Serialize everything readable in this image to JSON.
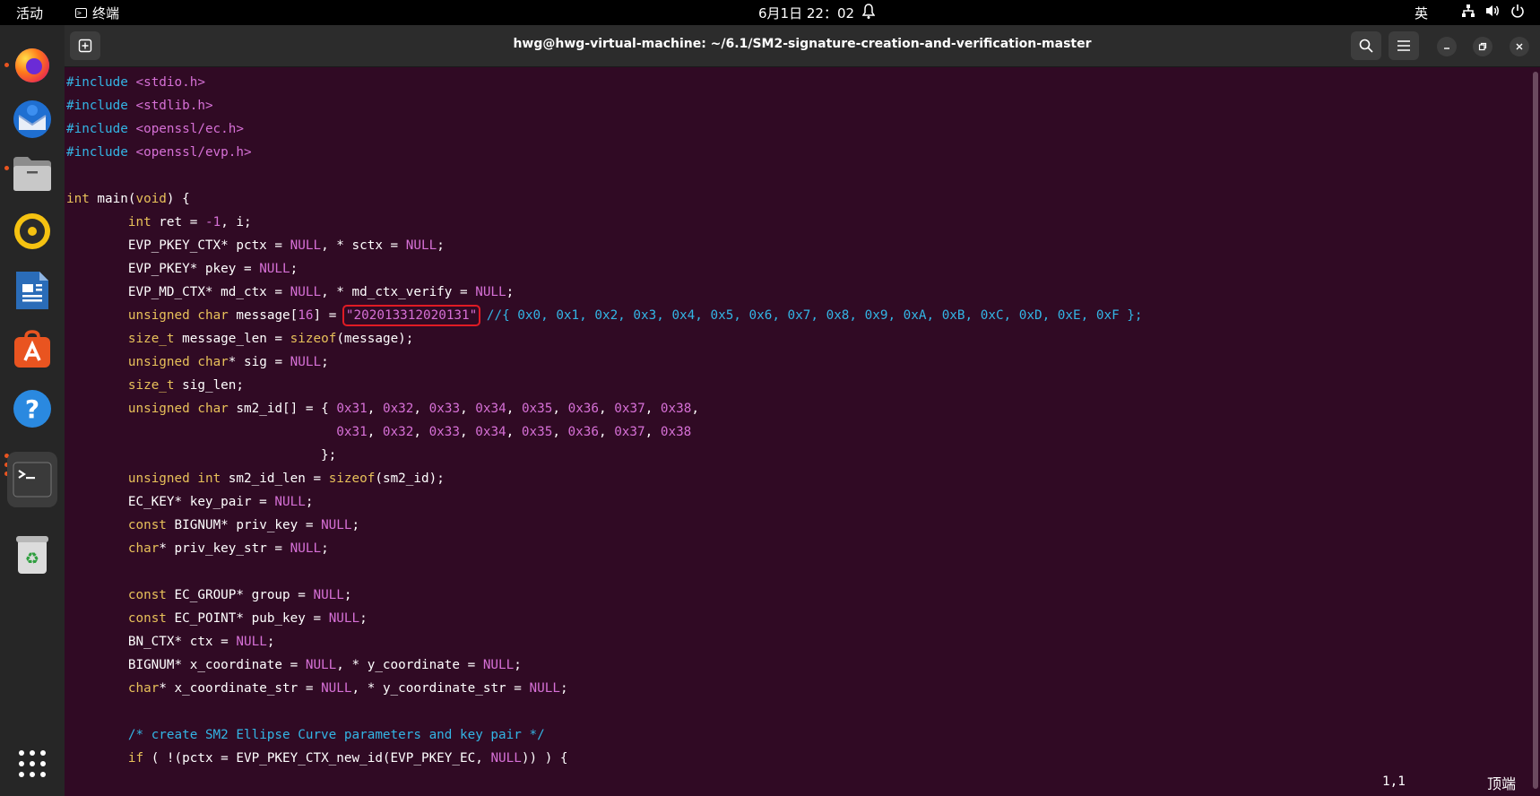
{
  "topbar": {
    "activities": "活动",
    "app_name": "终端",
    "clock": "6月1日 22：02",
    "input_method": "英"
  },
  "window": {
    "title": "hwg@hwg-virtual-machine: ~/6.1/SM2-signature-creation-and-verification-master"
  },
  "editor": {
    "lines": [
      "#include <stdio.h>",
      "#include <stdlib.h>",
      "#include <openssl/ec.h>",
      "#include <openssl/evp.h>",
      "",
      "int main(void) {",
      "        int ret = -1, i;",
      "        EVP_PKEY_CTX* pctx = NULL, * sctx = NULL;",
      "        EVP_PKEY* pkey = NULL;",
      "        EVP_MD_CTX* md_ctx = NULL, * md_ctx_verify = NULL;",
      "        unsigned char message[16] = \"202013312020131\" //{ 0x0, 0x1, 0x2, 0x3, 0x4, 0x5, 0x6, 0x7, 0x8, 0x9, 0xA, 0xB, 0xC, 0xD, 0xE, 0xF };",
      "        size_t message_len = sizeof(message);",
      "        unsigned char* sig = NULL;",
      "        size_t sig_len;",
      "        unsigned char sm2_id[] = { 0x31, 0x32, 0x33, 0x34, 0x35, 0x36, 0x37, 0x38,",
      "                                   0x31, 0x32, 0x33, 0x34, 0x35, 0x36, 0x37, 0x38",
      "                                 };",
      "        unsigned int sm2_id_len = sizeof(sm2_id);",
      "        EC_KEY* key_pair = NULL;",
      "        const BIGNUM* priv_key = NULL;",
      "        char* priv_key_str = NULL;",
      "",
      "        const EC_GROUP* group = NULL;",
      "        const EC_POINT* pub_key = NULL;",
      "        BN_CTX* ctx = NULL;",
      "        BIGNUM* x_coordinate = NULL, * y_coordinate = NULL;",
      "        char* x_coordinate_str = NULL, * y_coordinate_str = NULL;",
      "",
      "        /* create SM2 Ellipse Curve parameters and key pair */",
      "        if ( !(pctx = EVP_PKEY_CTX_new_id(EVP_PKEY_EC, NULL)) ) {"
    ],
    "highlighted_string": "\"202013312020131\""
  },
  "status": {
    "cursor_position": "1,1",
    "scroll_position": "顶端"
  },
  "dock_apps": [
    "firefox-icon",
    "thunderbird-icon",
    "files-icon",
    "rhythmbox-icon",
    "writer-icon",
    "app-center-icon",
    "help-icon",
    "terminal-icon",
    "trash-icon",
    "show-apps-icon"
  ],
  "colors": {
    "terminal_bg": "#300a24",
    "highlight_border": "#e01b24",
    "accent": "#e95420"
  }
}
